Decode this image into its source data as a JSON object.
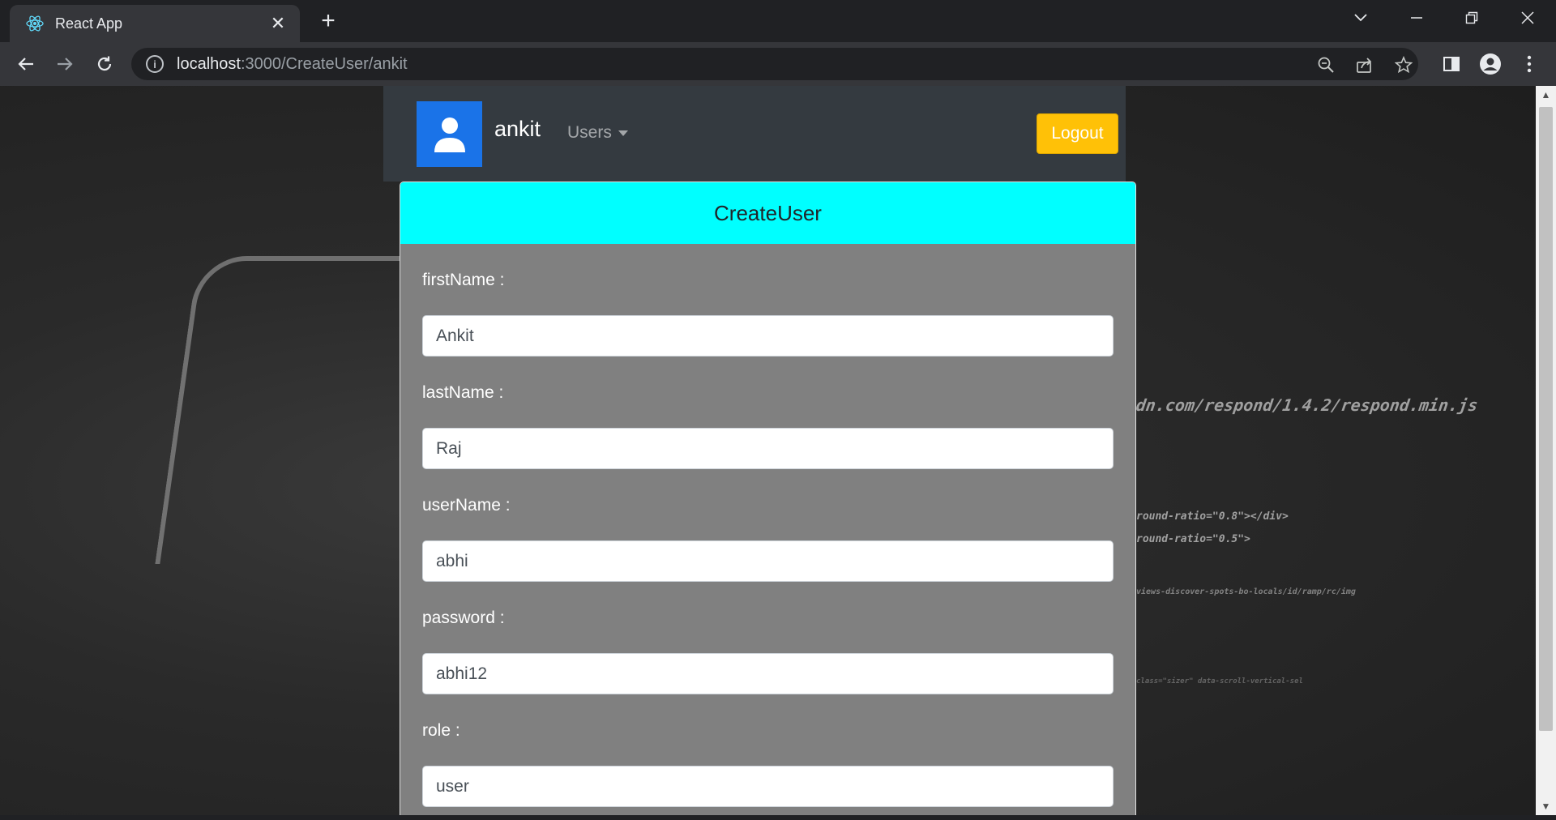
{
  "browser": {
    "tab_title": "React App",
    "url_host": "localhost",
    "url_path": ":3000/CreateUser/ankit"
  },
  "navbar": {
    "username": "ankit",
    "users_menu_label": "Users",
    "logout_label": "Logout"
  },
  "form": {
    "title": "CreateUser",
    "fields": [
      {
        "label": "firstName :",
        "value": "Ankit"
      },
      {
        "label": "lastName :",
        "value": "Raj"
      },
      {
        "label": "userName :",
        "value": "abhi"
      },
      {
        "label": "password :",
        "value": "abhi12"
      },
      {
        "label": "role :",
        "value": "user"
      }
    ]
  },
  "background_code": {
    "line1": "dn.com/respond/1.4.2/respond.min.js",
    "line2": "round-ratio=\"0.8\"></div>",
    "line3": "round-ratio=\"0.5\">",
    "line4": "views-discover-spots-bo-locals/id/ramp/rc/img",
    "line5": "class=\"sizer\" data-scroll-vertical-sel"
  },
  "colors": {
    "header_accent": "#00ffff",
    "logout_button": "#ffc107",
    "avatar_bg": "#1a73e8",
    "navbar_bg": "#343a40",
    "card_bg": "#808080"
  }
}
